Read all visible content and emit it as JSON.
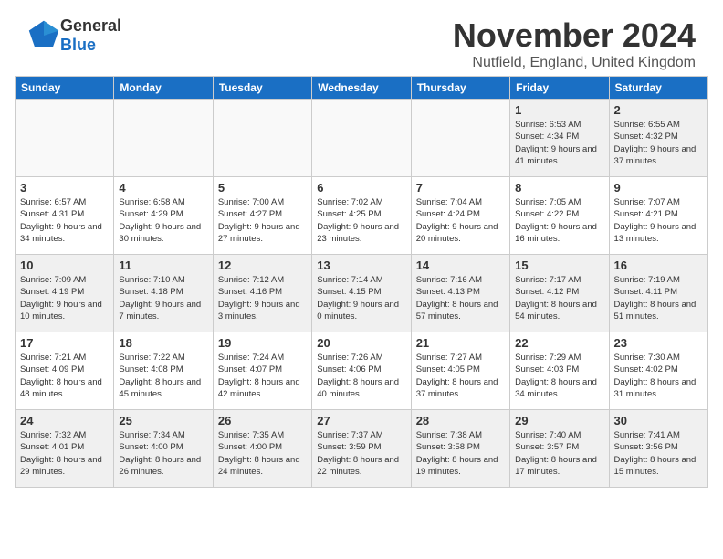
{
  "header": {
    "logo_general": "General",
    "logo_blue": "Blue",
    "month_title": "November 2024",
    "location": "Nutfield, England, United Kingdom"
  },
  "weekdays": [
    "Sunday",
    "Monday",
    "Tuesday",
    "Wednesday",
    "Thursday",
    "Friday",
    "Saturday"
  ],
  "weeks": [
    [
      {
        "day": "",
        "info": ""
      },
      {
        "day": "",
        "info": ""
      },
      {
        "day": "",
        "info": ""
      },
      {
        "day": "",
        "info": ""
      },
      {
        "day": "",
        "info": ""
      },
      {
        "day": "1",
        "info": "Sunrise: 6:53 AM\nSunset: 4:34 PM\nDaylight: 9 hours and 41 minutes."
      },
      {
        "day": "2",
        "info": "Sunrise: 6:55 AM\nSunset: 4:32 PM\nDaylight: 9 hours and 37 minutes."
      }
    ],
    [
      {
        "day": "3",
        "info": "Sunrise: 6:57 AM\nSunset: 4:31 PM\nDaylight: 9 hours and 34 minutes."
      },
      {
        "day": "4",
        "info": "Sunrise: 6:58 AM\nSunset: 4:29 PM\nDaylight: 9 hours and 30 minutes."
      },
      {
        "day": "5",
        "info": "Sunrise: 7:00 AM\nSunset: 4:27 PM\nDaylight: 9 hours and 27 minutes."
      },
      {
        "day": "6",
        "info": "Sunrise: 7:02 AM\nSunset: 4:25 PM\nDaylight: 9 hours and 23 minutes."
      },
      {
        "day": "7",
        "info": "Sunrise: 7:04 AM\nSunset: 4:24 PM\nDaylight: 9 hours and 20 minutes."
      },
      {
        "day": "8",
        "info": "Sunrise: 7:05 AM\nSunset: 4:22 PM\nDaylight: 9 hours and 16 minutes."
      },
      {
        "day": "9",
        "info": "Sunrise: 7:07 AM\nSunset: 4:21 PM\nDaylight: 9 hours and 13 minutes."
      }
    ],
    [
      {
        "day": "10",
        "info": "Sunrise: 7:09 AM\nSunset: 4:19 PM\nDaylight: 9 hours and 10 minutes."
      },
      {
        "day": "11",
        "info": "Sunrise: 7:10 AM\nSunset: 4:18 PM\nDaylight: 9 hours and 7 minutes."
      },
      {
        "day": "12",
        "info": "Sunrise: 7:12 AM\nSunset: 4:16 PM\nDaylight: 9 hours and 3 minutes."
      },
      {
        "day": "13",
        "info": "Sunrise: 7:14 AM\nSunset: 4:15 PM\nDaylight: 9 hours and 0 minutes."
      },
      {
        "day": "14",
        "info": "Sunrise: 7:16 AM\nSunset: 4:13 PM\nDaylight: 8 hours and 57 minutes."
      },
      {
        "day": "15",
        "info": "Sunrise: 7:17 AM\nSunset: 4:12 PM\nDaylight: 8 hours and 54 minutes."
      },
      {
        "day": "16",
        "info": "Sunrise: 7:19 AM\nSunset: 4:11 PM\nDaylight: 8 hours and 51 minutes."
      }
    ],
    [
      {
        "day": "17",
        "info": "Sunrise: 7:21 AM\nSunset: 4:09 PM\nDaylight: 8 hours and 48 minutes."
      },
      {
        "day": "18",
        "info": "Sunrise: 7:22 AM\nSunset: 4:08 PM\nDaylight: 8 hours and 45 minutes."
      },
      {
        "day": "19",
        "info": "Sunrise: 7:24 AM\nSunset: 4:07 PM\nDaylight: 8 hours and 42 minutes."
      },
      {
        "day": "20",
        "info": "Sunrise: 7:26 AM\nSunset: 4:06 PM\nDaylight: 8 hours and 40 minutes."
      },
      {
        "day": "21",
        "info": "Sunrise: 7:27 AM\nSunset: 4:05 PM\nDaylight: 8 hours and 37 minutes."
      },
      {
        "day": "22",
        "info": "Sunrise: 7:29 AM\nSunset: 4:03 PM\nDaylight: 8 hours and 34 minutes."
      },
      {
        "day": "23",
        "info": "Sunrise: 7:30 AM\nSunset: 4:02 PM\nDaylight: 8 hours and 31 minutes."
      }
    ],
    [
      {
        "day": "24",
        "info": "Sunrise: 7:32 AM\nSunset: 4:01 PM\nDaylight: 8 hours and 29 minutes."
      },
      {
        "day": "25",
        "info": "Sunrise: 7:34 AM\nSunset: 4:00 PM\nDaylight: 8 hours and 26 minutes."
      },
      {
        "day": "26",
        "info": "Sunrise: 7:35 AM\nSunset: 4:00 PM\nDaylight: 8 hours and 24 minutes."
      },
      {
        "day": "27",
        "info": "Sunrise: 7:37 AM\nSunset: 3:59 PM\nDaylight: 8 hours and 22 minutes."
      },
      {
        "day": "28",
        "info": "Sunrise: 7:38 AM\nSunset: 3:58 PM\nDaylight: 8 hours and 19 minutes."
      },
      {
        "day": "29",
        "info": "Sunrise: 7:40 AM\nSunset: 3:57 PM\nDaylight: 8 hours and 17 minutes."
      },
      {
        "day": "30",
        "info": "Sunrise: 7:41 AM\nSunset: 3:56 PM\nDaylight: 8 hours and 15 minutes."
      }
    ]
  ]
}
